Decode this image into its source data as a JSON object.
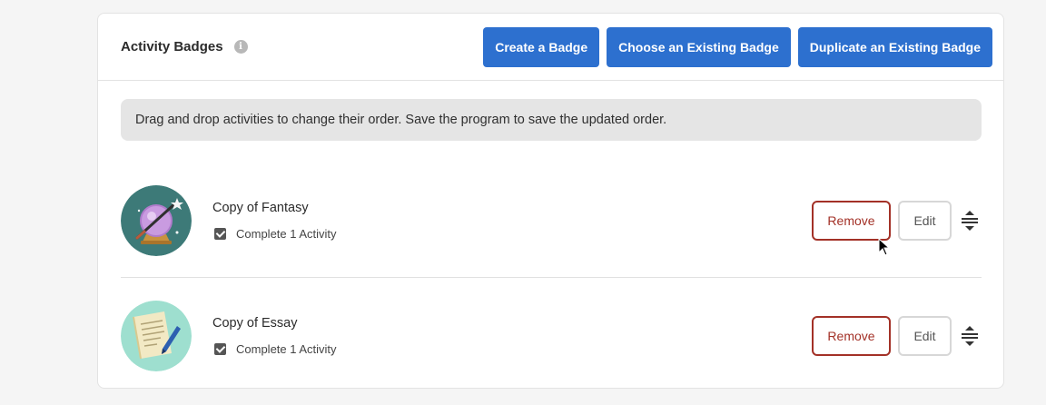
{
  "header": {
    "title": "Activity Badges",
    "info_icon_glyph": "i",
    "buttons": {
      "create": "Create a Badge",
      "choose": "Choose an Existing Badge",
      "duplicate": "Duplicate an Existing Badge"
    }
  },
  "notice": "Drag and drop activities to change their order. Save the program to save the updated order.",
  "badges": [
    {
      "name": "Copy of Fantasy",
      "requirement": "Complete 1 Activity",
      "icon": "crystal-ball-icon",
      "remove_label": "Remove",
      "edit_label": "Edit"
    },
    {
      "name": "Copy of Essay",
      "requirement": "Complete 1 Activity",
      "icon": "paper-pen-icon",
      "remove_label": "Remove",
      "edit_label": "Edit"
    }
  ],
  "colors": {
    "primary": "#2d70cf",
    "danger": "#a33127",
    "notice_bg": "#e5e5e5",
    "fantasy_bg": "#3d7a78",
    "essay_bg": "#9edfcf"
  }
}
